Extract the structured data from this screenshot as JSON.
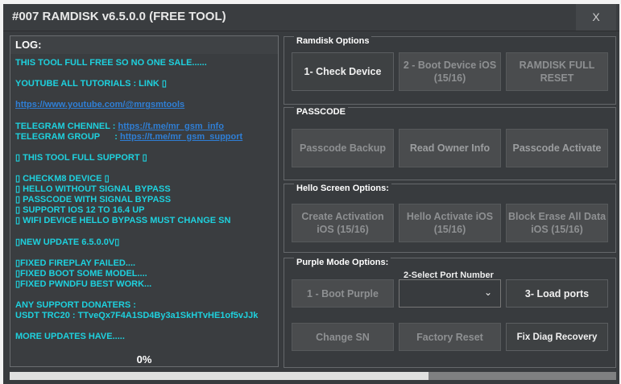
{
  "window": {
    "title": "#007 RAMDISK v6.5.0.0 (FREE TOOL)",
    "close_label": "X"
  },
  "log": {
    "header": "LOG:",
    "lines": [
      {
        "text": "THIS TOOL FULL FREE SO NO ONE SALE......"
      },
      {
        "text": ""
      },
      {
        "text": "YOUTUBE ALL TUTORIALS : LINK ▯"
      },
      {
        "text": ""
      },
      {
        "text": "",
        "link": "https://www.youtube.com/@mrgsmtools"
      },
      {
        "text": ""
      },
      {
        "text": "TELEGRAM CHENNEL : ",
        "link": "https://t.me/mr_gsm_info"
      },
      {
        "text": "TELEGRAM GROUP      : ",
        "link": "https://t.me/mr_gsm_support"
      },
      {
        "text": ""
      },
      {
        "text": "▯ THIS TOOL FULL SUPPORT ▯"
      },
      {
        "text": ""
      },
      {
        "text": "▯ CHECKM8 DEVICE ▯"
      },
      {
        "text": "▯ HELLO WITHOUT SIGNAL BYPASS"
      },
      {
        "text": "▯ PASSCODE WITH SIGNAL BYPASS"
      },
      {
        "text": "▯ SUPPORT IOS 12 TO 16.4 UP"
      },
      {
        "text": "▯ WIFI DEVICE HELLO BYPASS MUST CHANGE SN"
      },
      {
        "text": ""
      },
      {
        "text": "▯NEW UPDATE 6.5.0.0V▯"
      },
      {
        "text": ""
      },
      {
        "text": "▯FIXED FIREPLAY FAILED...."
      },
      {
        "text": "▯FIXED BOOT SOME MODEL...."
      },
      {
        "text": "▯FIXED PWNDFU BEST WORK..."
      },
      {
        "text": ""
      },
      {
        "text": "ANY SUPPORT DONATERS :"
      },
      {
        "text": "USDT TRC20 : TTveQx7F4A1SD4By3a1SkHTvHE1of5vJJk"
      },
      {
        "text": ""
      },
      {
        "text": "MORE UPDATES HAVE....."
      }
    ],
    "progress_text": "0%"
  },
  "ramdisk": {
    "title": "Ramdisk Options",
    "buttons": [
      "1- Check Device",
      "2 - Boot Device iOS (15/16)",
      "RAMDISK FULL RESET"
    ]
  },
  "passcode": {
    "title": "PASSCODE",
    "buttons": [
      "Passcode Backup",
      "Read Owner Info",
      "Passcode Activate"
    ]
  },
  "hello": {
    "title": "Hello Screen Options:",
    "buttons": [
      "Create Activation iOS (15/16)",
      "Hello Activate iOS (15/16)",
      "Block Erase All Data iOS (15/16)"
    ]
  },
  "purple": {
    "title": "Purple Mode Options:",
    "port_label": "2-Select Port Number",
    "port_value": "",
    "boot": "1 - Boot Purple",
    "load": "3- Load ports",
    "change_sn": "Change SN",
    "factory": "Factory Reset",
    "diag": "Fix Diag Recovery"
  },
  "progress": {
    "percent": 69
  },
  "colors": {
    "log_text": "#1ed1de",
    "link": "#2f7fd6",
    "background": "#383b3e"
  }
}
